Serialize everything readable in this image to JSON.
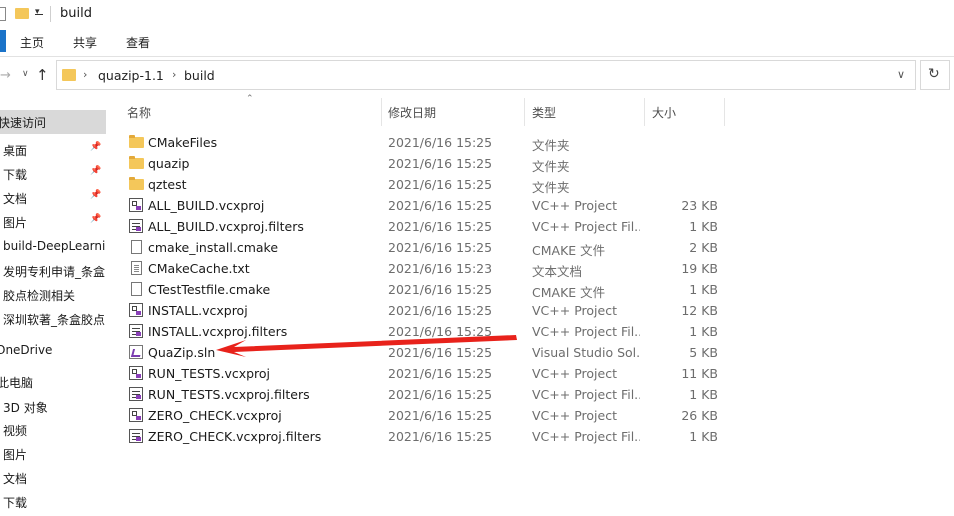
{
  "window": {
    "title": "build"
  },
  "ribbon": {
    "tabs": [
      "主页",
      "共享",
      "查看"
    ]
  },
  "address": {
    "crumbs": [
      "quazip-1.1",
      "build"
    ]
  },
  "nav": {
    "items": [
      {
        "label": "快速访问",
        "pinned": false,
        "selected": true
      },
      {
        "label": "桌面",
        "pinned": true
      },
      {
        "label": "下载",
        "pinned": true
      },
      {
        "label": "文档",
        "pinned": true
      },
      {
        "label": "图片",
        "pinned": true
      },
      {
        "label": "build-DeepLearnin",
        "pinned": false
      },
      {
        "label": "发明专利申请_条盒",
        "pinned": false
      },
      {
        "label": "胶点检测相关",
        "pinned": false
      },
      {
        "label": "深圳软著_条盒胶点",
        "pinned": false
      },
      {
        "label": "OneDrive",
        "pinned": false
      },
      {
        "label": "此电脑",
        "pinned": false
      },
      {
        "label": "3D 对象",
        "pinned": false
      },
      {
        "label": "视频",
        "pinned": false
      },
      {
        "label": "图片",
        "pinned": false
      },
      {
        "label": "文档",
        "pinned": false
      },
      {
        "label": "下载",
        "pinned": false
      }
    ]
  },
  "columns": {
    "name": "名称",
    "date": "修改日期",
    "type": "类型",
    "size": "大小"
  },
  "files": [
    {
      "icon": "folder",
      "name": "CMakeFiles",
      "date": "2021/6/16 15:25",
      "type": "文件夹",
      "size": ""
    },
    {
      "icon": "folder",
      "name": "quazip",
      "date": "2021/6/16 15:25",
      "type": "文件夹",
      "size": ""
    },
    {
      "icon": "folder",
      "name": "qztest",
      "date": "2021/6/16 15:25",
      "type": "文件夹",
      "size": ""
    },
    {
      "icon": "vcxproj",
      "name": "ALL_BUILD.vcxproj",
      "date": "2021/6/16 15:25",
      "type": "VC++ Project",
      "size": "23 KB"
    },
    {
      "icon": "filters",
      "name": "ALL_BUILD.vcxproj.filters",
      "date": "2021/6/16 15:25",
      "type": "VC++ Project Fil...",
      "size": "1 KB"
    },
    {
      "icon": "doc",
      "name": "cmake_install.cmake",
      "date": "2021/6/16 15:25",
      "type": "CMAKE 文件",
      "size": "2 KB"
    },
    {
      "icon": "txt",
      "name": "CMakeCache.txt",
      "date": "2021/6/16 15:23",
      "type": "文本文档",
      "size": "19 KB"
    },
    {
      "icon": "doc",
      "name": "CTestTestfile.cmake",
      "date": "2021/6/16 15:25",
      "type": "CMAKE 文件",
      "size": "1 KB"
    },
    {
      "icon": "vcxproj",
      "name": "INSTALL.vcxproj",
      "date": "2021/6/16 15:25",
      "type": "VC++ Project",
      "size": "12 KB"
    },
    {
      "icon": "filters",
      "name": "INSTALL.vcxproj.filters",
      "date": "2021/6/16 15:25",
      "type": "VC++ Project Fil...",
      "size": "1 KB"
    },
    {
      "icon": "sln",
      "name": "QuaZip.sln",
      "date": "2021/6/16 15:25",
      "type": "Visual Studio Sol...",
      "size": "5 KB"
    },
    {
      "icon": "vcxproj",
      "name": "RUN_TESTS.vcxproj",
      "date": "2021/6/16 15:25",
      "type": "VC++ Project",
      "size": "11 KB"
    },
    {
      "icon": "filters",
      "name": "RUN_TESTS.vcxproj.filters",
      "date": "2021/6/16 15:25",
      "type": "VC++ Project Fil...",
      "size": "1 KB"
    },
    {
      "icon": "vcxproj",
      "name": "ZERO_CHECK.vcxproj",
      "date": "2021/6/16 15:25",
      "type": "VC++ Project",
      "size": "26 KB"
    },
    {
      "icon": "filters",
      "name": "ZERO_CHECK.vcxproj.filters",
      "date": "2021/6/16 15:25",
      "type": "VC++ Project Fil...",
      "size": "1 KB"
    }
  ],
  "colors": {
    "accent": "#1a73c9",
    "arrow": "#e8221b",
    "folder": "#f4c75a"
  }
}
